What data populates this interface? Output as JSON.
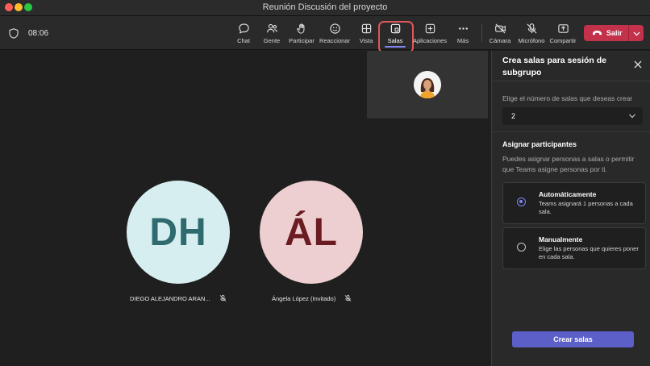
{
  "window": {
    "title": "Reunión Discusión del proyecto"
  },
  "meeting": {
    "timer": "08:06"
  },
  "toolbar": {
    "items": [
      {
        "label": "Chat",
        "icon": "chat-icon"
      },
      {
        "label": "Gente",
        "icon": "people-icon"
      },
      {
        "label": "Participar",
        "icon": "raise-hand-icon"
      },
      {
        "label": "Reaccionar",
        "icon": "smile-icon"
      },
      {
        "label": "Vista",
        "icon": "view-grid-icon"
      },
      {
        "label": "Salas",
        "icon": "breakout-rooms-icon",
        "active": true
      },
      {
        "label": "Aplicaciones",
        "icon": "apps-plus-icon"
      },
      {
        "label": "Más",
        "icon": "more-dots-icon"
      },
      {
        "label": "Cámara",
        "icon": "camera-off-icon"
      },
      {
        "label": "Micrófono",
        "icon": "mic-off-icon"
      },
      {
        "label": "Compartir",
        "icon": "share-icon"
      }
    ],
    "leave_label": "Salir"
  },
  "participants": [
    {
      "initials": "DH",
      "name": "DIEGO ALEJANDRO ARAN...",
      "muted": true,
      "color": "#2f6b6e",
      "bg": "#d7eef0"
    },
    {
      "initials": "ÁL",
      "name": "Ángela López (Invitado)",
      "muted": true,
      "color": "#6b1b22",
      "bg": "#edcfd1"
    }
  ],
  "panel": {
    "title": "Crea salas para sesión de subgrupo",
    "rooms_prompt": "Elige el número de salas que deseas crear",
    "rooms_value": "2",
    "assign_title": "Asignar participantes",
    "assign_desc": "Puedes asignar personas a salas o permitir que Teams asigne personas por ti.",
    "options": [
      {
        "title": "Automáticamente",
        "desc": "Teams asignará 1 personas a cada sala.",
        "selected": true
      },
      {
        "title": "Manualmente",
        "desc": "Elige las personas que quieres poner en cada sala.",
        "selected": false
      }
    ],
    "create_label": "Crear salas"
  },
  "colors": {
    "accent": "#5b5fc7",
    "leave": "#c4314b",
    "highlight": "#e0565b"
  }
}
